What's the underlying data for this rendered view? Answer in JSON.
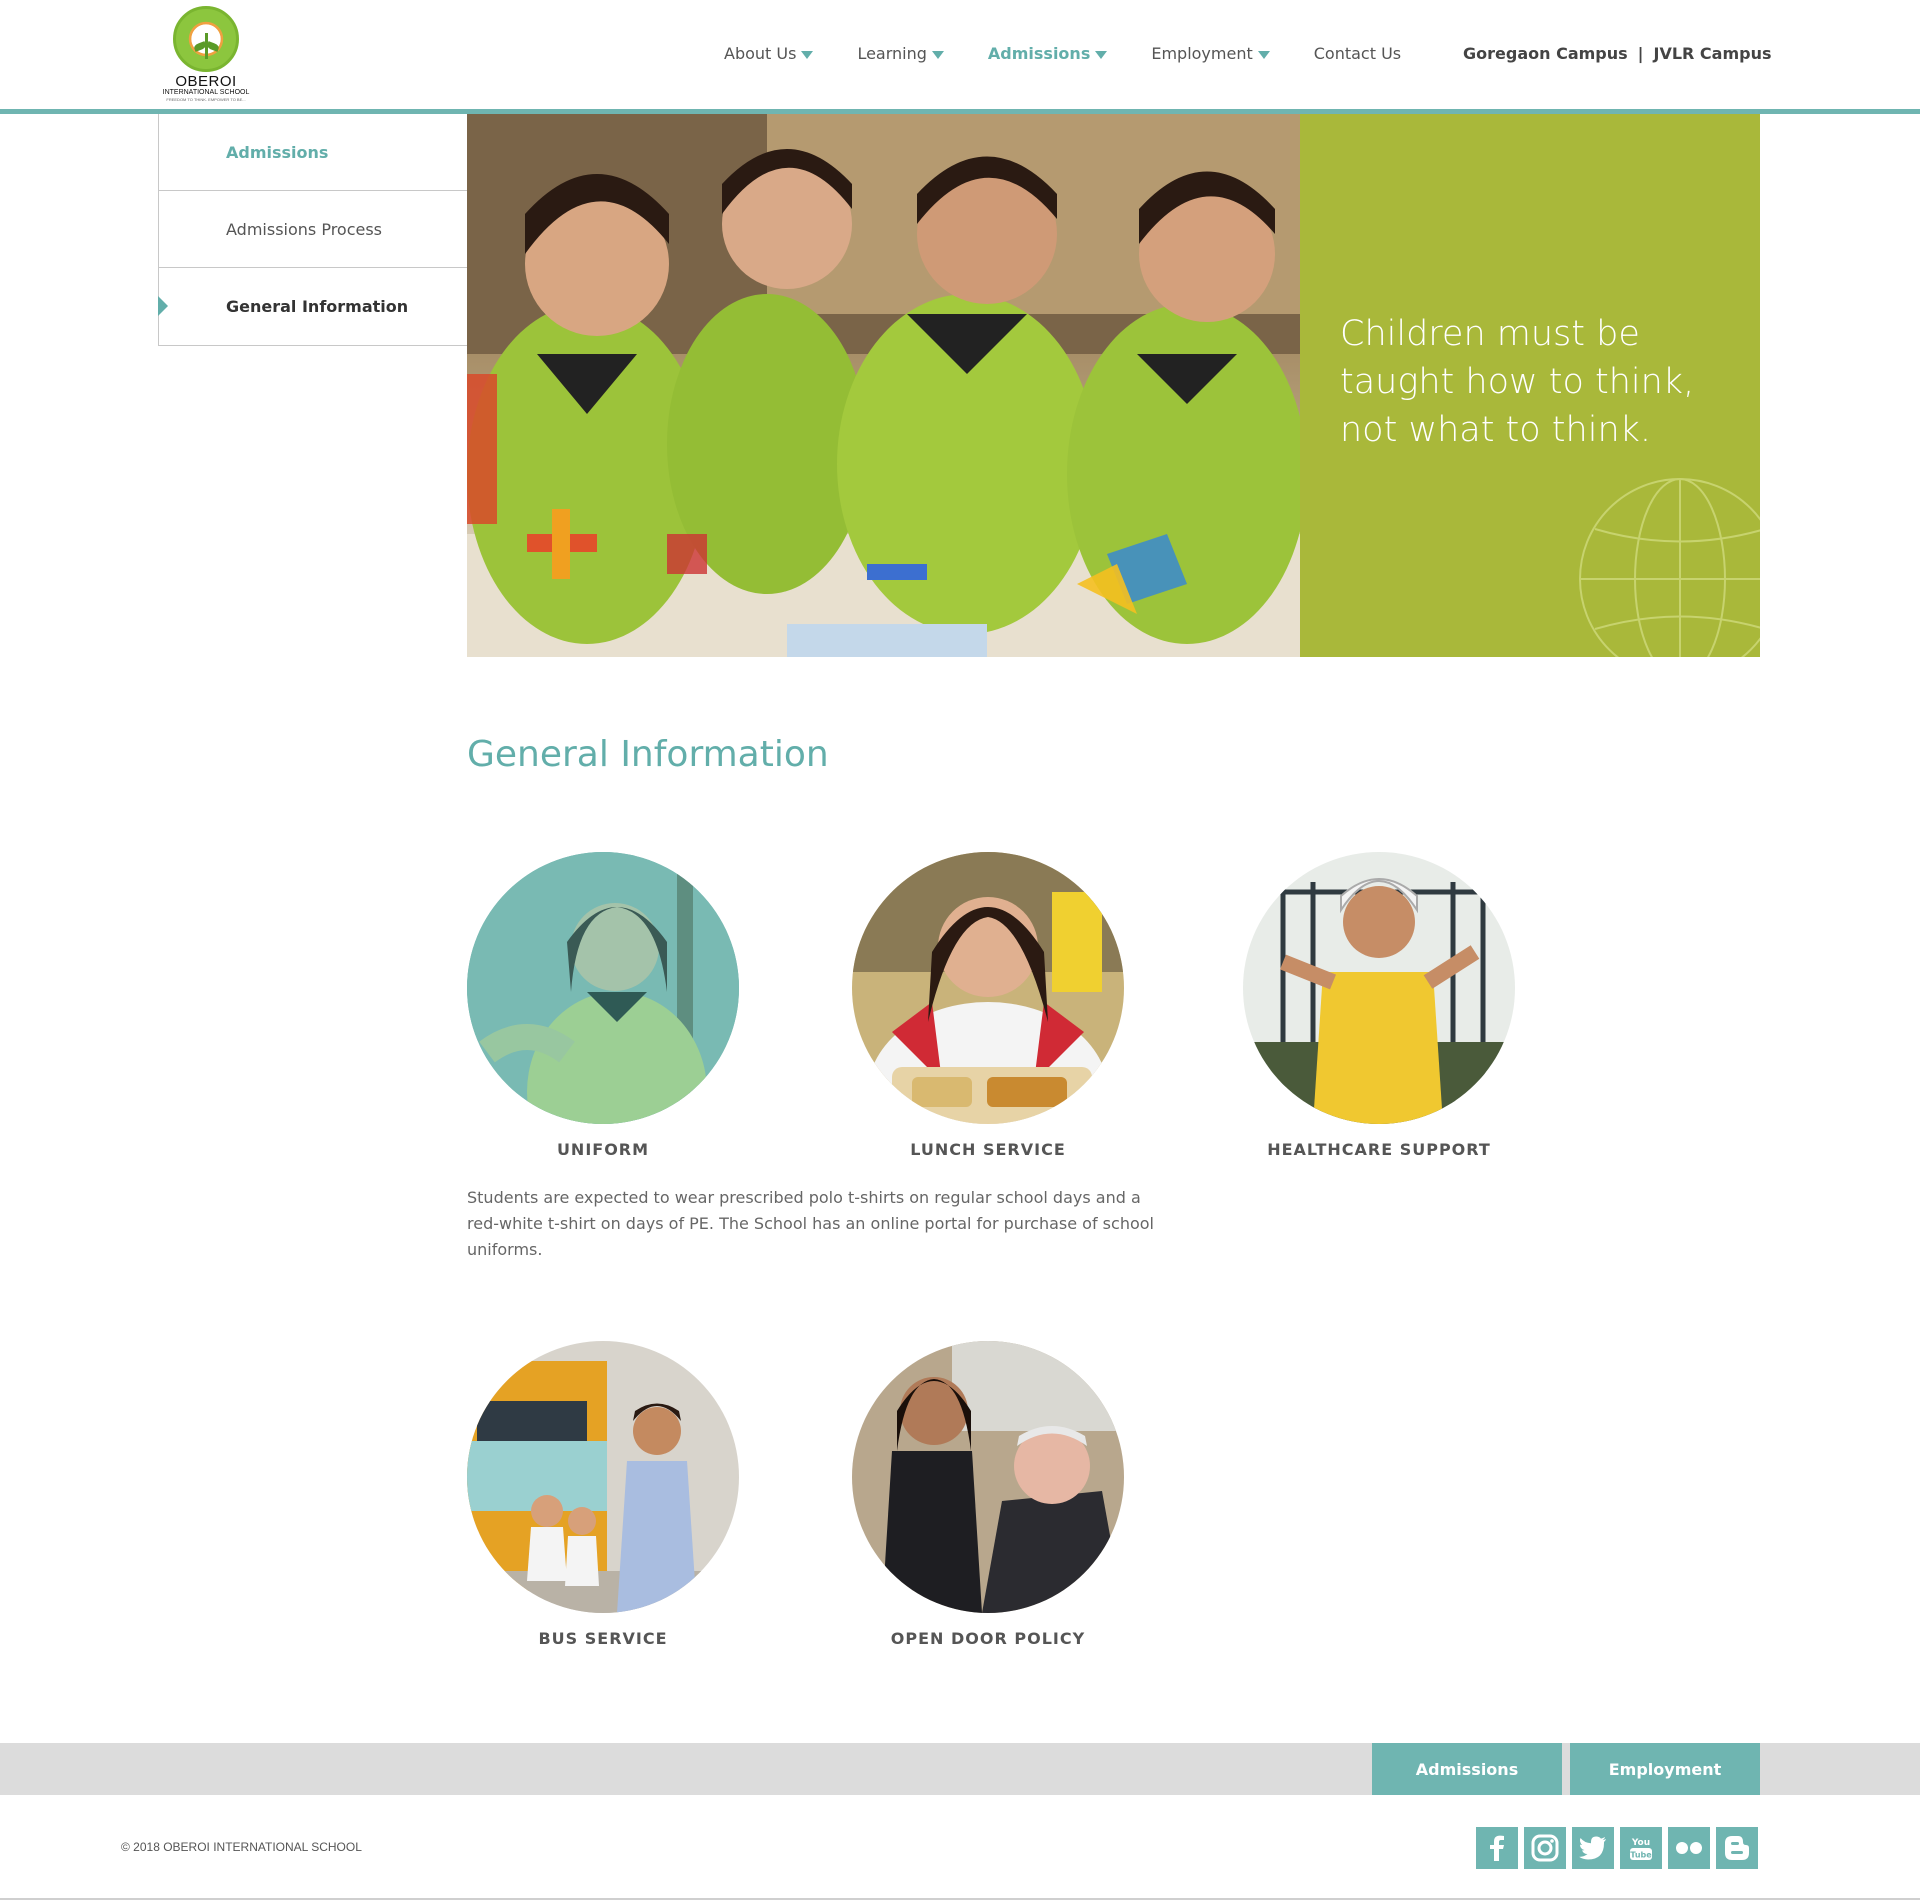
{
  "logo": {
    "name": "OBEROI",
    "sub": "INTERNATIONAL SCHOOL",
    "tagline": "FREEDOM TO THINK. EMPOWER TO BE..."
  },
  "nav": {
    "items": [
      {
        "label": "About Us",
        "dropdown": true
      },
      {
        "label": "Learning",
        "dropdown": true
      },
      {
        "label": "Admissions",
        "dropdown": true,
        "active": true
      },
      {
        "label": "Employment",
        "dropdown": true
      },
      {
        "label": "Contact Us",
        "dropdown": false
      }
    ],
    "campus": {
      "first": "Goregaon Campus",
      "separator": "|",
      "second": "JVLR Campus"
    }
  },
  "sidemenu": {
    "items": [
      {
        "label": "Admissions"
      },
      {
        "label": "Admissions Process"
      },
      {
        "label": "General Information"
      }
    ]
  },
  "hero": {
    "quote": "Children must be taught how to think, not what to think."
  },
  "content": {
    "title": "General Information",
    "cards": [
      {
        "label": "UNIFORM"
      },
      {
        "label": "LUNCH SERVICE"
      },
      {
        "label": "HEALTHCARE SUPPORT"
      },
      {
        "label": "BUS SERVICE"
      },
      {
        "label": "OPEN DOOR POLICY"
      }
    ],
    "description": "Students are expected to wear prescribed polo t-shirts on regular school days and a red-white t-shirt on days of PE. The School has an online portal for purchase of school uniforms."
  },
  "footer": {
    "buttons": {
      "admissions": "Admissions",
      "employment": "Employment"
    },
    "copyright": "© 2018 OBEROI INTERNATIONAL SCHOOL",
    "social": [
      "facebook-icon",
      "instagram-icon",
      "twitter-icon",
      "youtube-icon",
      "flickr-icon",
      "blogger-icon"
    ]
  },
  "colors": {
    "accent": "#62aeaa",
    "hero_quote_bg": "#a9b83a",
    "footer_bar": "#dcdcdc"
  }
}
